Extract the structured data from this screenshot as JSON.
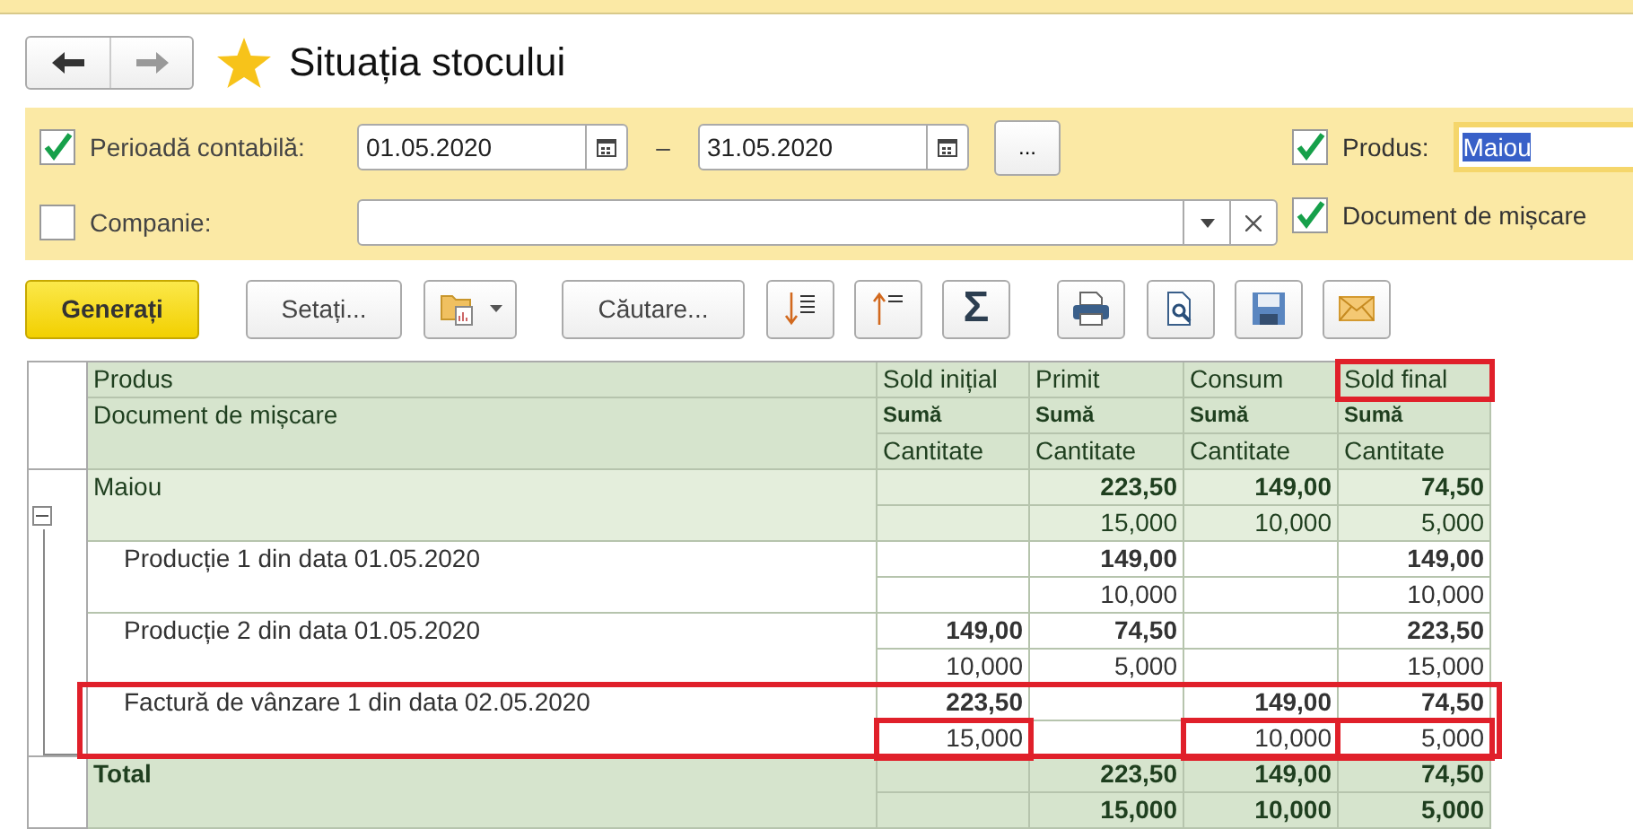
{
  "title": "Situația stocului",
  "filters": {
    "period": {
      "checked": true,
      "label": "Perioadă contabilă:",
      "from": "01.05.2020",
      "separator": "–",
      "to": "31.05.2020",
      "more": "..."
    },
    "company": {
      "checked": false,
      "label": "Companie:"
    },
    "product": {
      "checked": true,
      "label": "Produs:",
      "value": "Maiou"
    },
    "movement_document": {
      "checked": true,
      "label": "Document de mișcare"
    }
  },
  "toolbar": {
    "generate": "Generați",
    "settings": "Setați...",
    "search": "Căutare...",
    "sum": "Σ"
  },
  "table": {
    "header": [
      "Produs",
      "Document de mișcare"
    ],
    "columns": [
      {
        "label": "Sold inițial",
        "highlighted": false,
        "sum_label": "Sumă",
        "qty_label": "Cantitate"
      },
      {
        "label": "Primit",
        "highlighted": false,
        "sum_label": "Sumă",
        "qty_label": "Cantitate"
      },
      {
        "label": "Consum",
        "highlighted": false,
        "sum_label": "Sumă",
        "qty_label": "Cantitate"
      },
      {
        "label": "Sold final",
        "highlighted": true,
        "sum_label": "Sumă",
        "qty_label": "Cantitate"
      }
    ],
    "groups": [
      {
        "label": "Maiou",
        "expanded": true,
        "cells": [
          {
            "qty_highlighted": false
          },
          {
            "sum": "223,50",
            "qty": "15,000",
            "qty_highlighted": false
          },
          {
            "sum": "149,00",
            "qty": "10,000",
            "qty_highlighted": false
          },
          {
            "sum": "74,50",
            "qty": "5,000",
            "qty_highlighted": false
          }
        ],
        "children": [
          {
            "label": "Producție 1 din data 01.05.2020",
            "highlighted": false,
            "cells": [
              {
                "qty_highlighted": false
              },
              {
                "sum": "149,00",
                "qty": "10,000",
                "qty_highlighted": false
              },
              {
                "qty_highlighted": false
              },
              {
                "sum": "149,00",
                "qty": "10,000",
                "qty_highlighted": false
              }
            ]
          },
          {
            "label": "Producție 2 din data 01.05.2020",
            "highlighted": false,
            "cells": [
              {
                "sum": "149,00",
                "qty": "10,000",
                "qty_highlighted": false
              },
              {
                "sum": "74,50",
                "qty": "5,000",
                "qty_highlighted": false
              },
              {
                "qty_highlighted": false
              },
              {
                "sum": "223,50",
                "qty": "15,000",
                "qty_highlighted": false
              }
            ]
          },
          {
            "label": "Factură de vânzare 1 din data 02.05.2020",
            "highlighted": true,
            "cells": [
              {
                "sum": "223,50",
                "qty": "15,000",
                "qty_highlighted": true
              },
              {
                "qty_highlighted": false
              },
              {
                "sum": "149,00",
                "qty": "10,000",
                "qty_highlighted": true
              },
              {
                "sum": "74,50",
                "qty": "5,000",
                "qty_highlighted": true
              }
            ]
          }
        ]
      }
    ],
    "total": {
      "label": "Total",
      "cells": [
        {
          "qty_highlighted": false
        },
        {
          "sum": "223,50",
          "qty": "15,000",
          "qty_highlighted": false
        },
        {
          "sum": "149,00",
          "qty": "10,000",
          "qty_highlighted": false
        },
        {
          "sum": "74,50",
          "qty": "5,000",
          "qty_highlighted": false
        }
      ]
    }
  }
}
